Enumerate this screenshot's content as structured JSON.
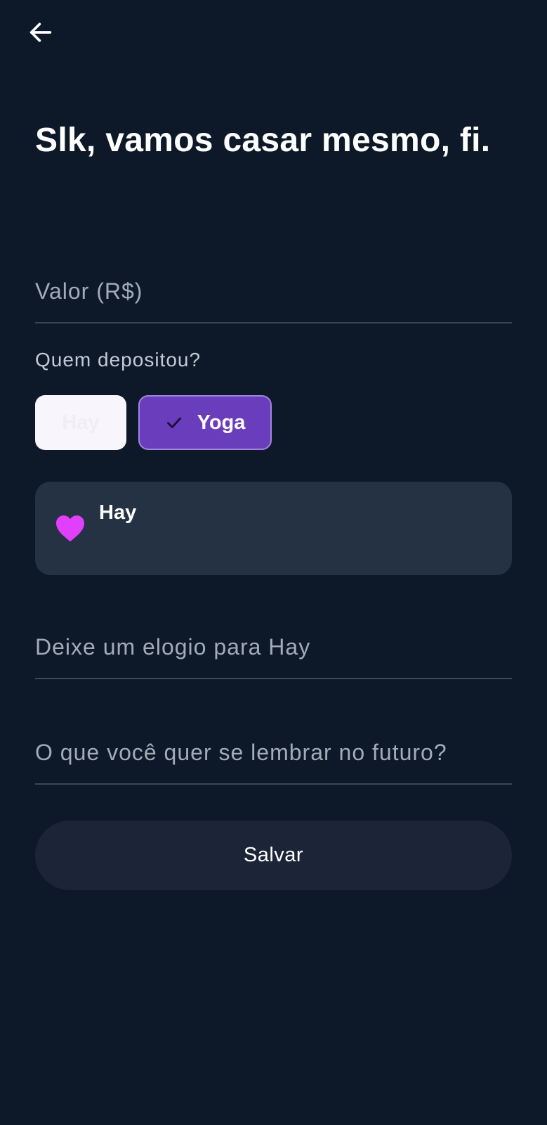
{
  "header": {
    "back_icon": "arrow-left-icon",
    "title": "Slk, vamos casar mesmo, fi."
  },
  "form": {
    "valor": {
      "placeholder": "Valor (R$)",
      "value": ""
    },
    "depositor": {
      "label": "Quem depositou?",
      "options": [
        {
          "label": "Hay",
          "selected": false
        },
        {
          "label": "Yoga",
          "selected": true,
          "icon": "check-icon"
        }
      ]
    },
    "selected_card": {
      "icon": "heart-icon",
      "name": "Hay",
      "icon_color": "#e040fb"
    },
    "elogio": {
      "placeholder": "Deixe um elogio para Hay",
      "value": ""
    },
    "lembrar": {
      "placeholder": "O que você quer se lembrar no futuro?",
      "value": ""
    },
    "save_label": "Salvar"
  },
  "colors": {
    "background": "#0d1929",
    "accent": "#6a3dbd",
    "card": "#253243",
    "button": "#1c2438"
  }
}
